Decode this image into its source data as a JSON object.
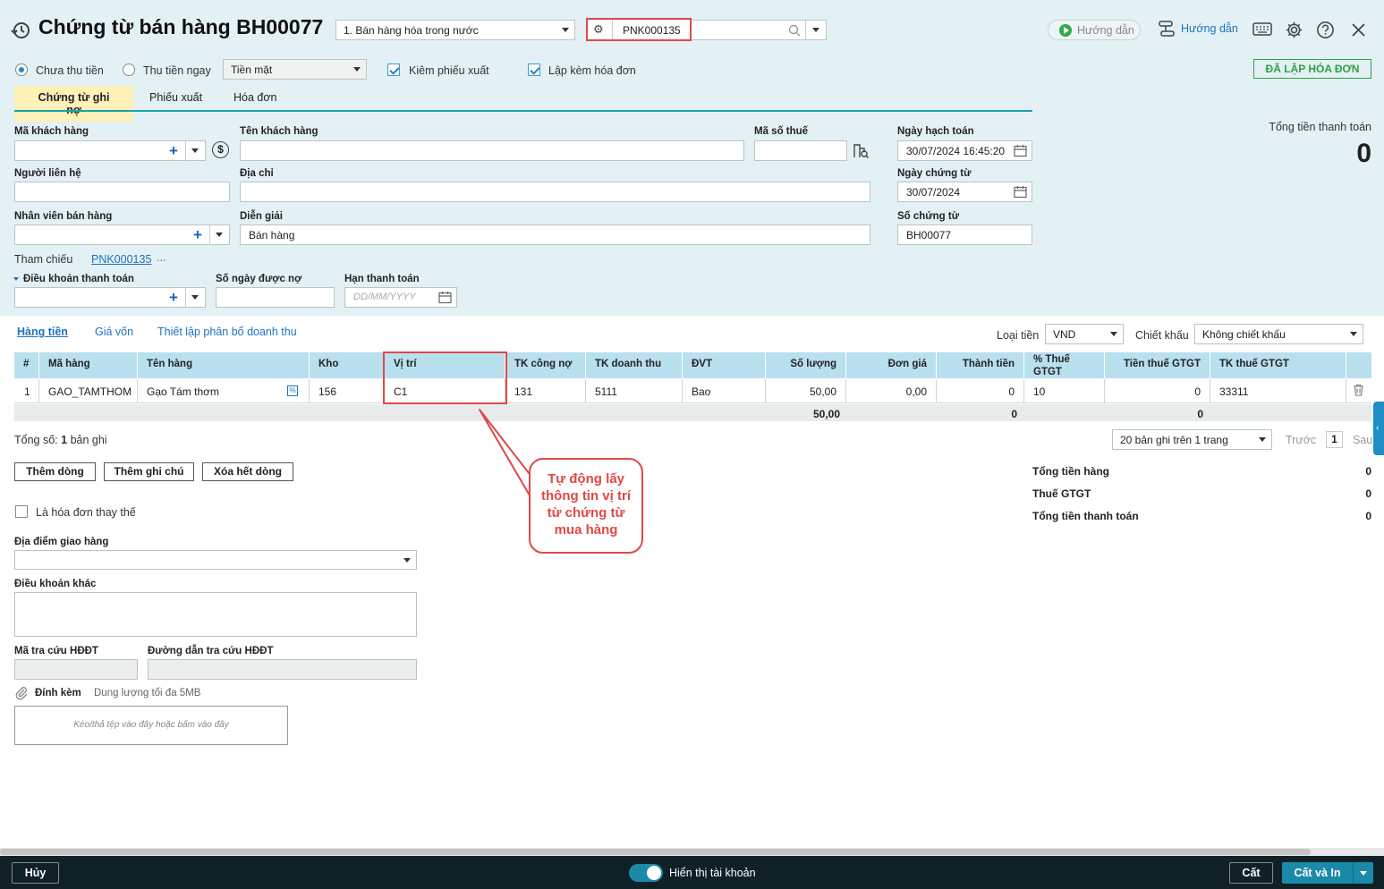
{
  "header": {
    "title": "Chứng từ bán hàng BH00077",
    "type_select": "1. Bán hàng hóa trong nước",
    "ref_code": "PNK000135",
    "guide_label": "Hướng dẫn",
    "guide_link": "Hướng dẫn"
  },
  "options": {
    "radio_unpaid": "Chưa thu tiền",
    "radio_paid": "Thu tiền ngay",
    "payment_method": "Tiền mặt",
    "check_export": "Kiêm phiếu xuất",
    "check_invoice": "Lập kèm hóa đơn",
    "status_button": "ĐÃ LẬP HÓA ĐƠN"
  },
  "tabs": [
    "Chứng từ ghi nợ",
    "Phiếu xuất",
    "Hóa đơn"
  ],
  "form": {
    "customer_code": "Mã khách hàng",
    "customer_name": "Tên khách hàng",
    "tax_code": "Mã số thuế",
    "accounting_date_label": "Ngày hạch toán",
    "accounting_date": "30/07/2024 16:45:20",
    "contact": "Người liên hệ",
    "address": "Địa chỉ",
    "voucher_date_label": "Ngày chứng từ",
    "voucher_date": "30/07/2024",
    "salesperson": "Nhân viên bán hàng",
    "description_label": "Diễn giải",
    "description": "Bán hàng",
    "voucher_no_label": "Số chứng từ",
    "voucher_no": "BH00077",
    "reference_label": "Tham chiếu",
    "reference_value": "PNK000135",
    "reference_more": "...",
    "payment_terms": "Điều khoản thanh toán",
    "credit_days": "Số ngày được nợ",
    "due_date": "Hạn thanh toán",
    "due_date_placeholder": "DD/MM/YYYY"
  },
  "total_top": {
    "label": "Tổng tiền thanh toán",
    "value": "0"
  },
  "subtabs": [
    "Hàng tiền",
    "Giá vốn",
    "Thiết lập phân bổ doanh thu"
  ],
  "currency": {
    "label": "Loại tiền",
    "value": "VND"
  },
  "discount": {
    "label": "Chiết khấu",
    "value": "Không chiết khấu"
  },
  "table": {
    "headers": [
      "#",
      "Mã hàng",
      "Tên hàng",
      "Kho",
      "Vị trí",
      "TK công nợ",
      "TK doanh thu",
      "ĐVT",
      "Số lượng",
      "Đơn giá",
      "Thành tiền",
      "% Thuế GTGT",
      "Tiền thuế GTGT",
      "TK thuế GTGT"
    ],
    "row": [
      "1",
      "GAO_TAMTHOM",
      "Gạo Tám thơm",
      "156",
      "C1",
      "131",
      "5111",
      "Bao",
      "50,00",
      "0,00",
      "0",
      "10",
      "0",
      "33311"
    ],
    "footer_qty": "50,00",
    "footer_amount": "0",
    "footer_tax": "0"
  },
  "paging": {
    "total_label": "Tổng số:",
    "total_count": "1",
    "total_suffix": "bản ghi",
    "page_size": "20 bản ghi trên 1 trang",
    "prev": "Trước",
    "page": "1",
    "next": "Sau"
  },
  "buttons": {
    "add_row": "Thêm dòng",
    "add_note": "Thêm ghi chú",
    "delete_all": "Xóa hết dòng"
  },
  "summary": [
    {
      "label": "Tổng tiền hàng",
      "value": "0"
    },
    {
      "label": "Thuế GTGT",
      "value": "0"
    },
    {
      "label": "Tổng tiền thanh toán",
      "value": "0"
    }
  ],
  "lower": {
    "replace_invoice": "Là hóa đơn thay thế",
    "delivery_place": "Địa điểm giao hàng",
    "other_terms": "Điều khoản khác",
    "lookup_code": "Mã tra cứu HĐĐT",
    "lookup_link": "Đường dẫn tra cứu HĐĐT",
    "attach": "Đính kèm",
    "attach_limit": "Dung lượng tối đa 5MB",
    "drop_hint": "Kéo/thả tệp vào đây hoặc bấm vào đây"
  },
  "callout": "Tự động lấy thông tin vị trí từ chứng từ mua hàng",
  "footer": {
    "cancel": "Hủy",
    "show_accounts": "Hiển thị tài khoản",
    "save": "Cất",
    "save_print": "Cất và In"
  },
  "colors": {
    "accent": "#1e8ec5",
    "highlight": "#e04848",
    "header_bg": "#e3f1f4",
    "footer_bg": "#0f2027",
    "save_print_bg": "#1a8aa8"
  }
}
